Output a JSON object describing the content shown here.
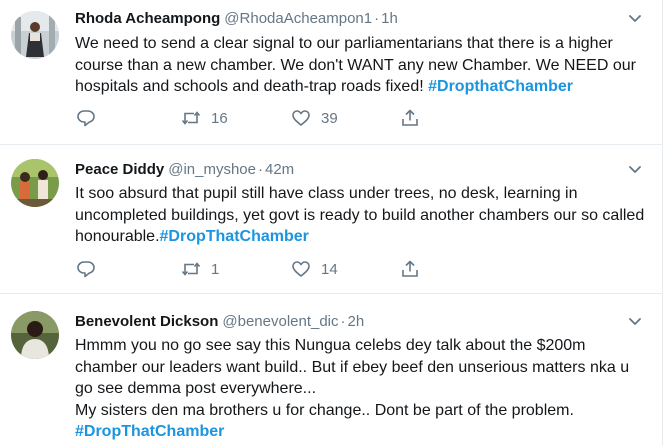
{
  "tweets": [
    {
      "name": "Rhoda Acheampong",
      "handle": "@RhodaAcheampon1",
      "dot": "·",
      "time": "1h",
      "text": "We need to send a clear signal to our parliamentarians that there is a higher course than a new chamber. We don't WANT any new Chamber. We NEED our hospitals and schools and death-trap roads fixed! ",
      "hashtag": "#DropthatChamber",
      "retweets": "16",
      "likes": "39",
      "avatar_color": "#b9c3c9"
    },
    {
      "name": "Peace Diddy",
      "handle": "@in_myshoe",
      "dot": "·",
      "time": "42m",
      "text": "It soo absurd that pupil still have class under trees, no desk, learning in uncompleted buildings, yet govt is ready to build another chambers our so called honourable.",
      "hashtag": "#DropThatChamber",
      "retweets": "1",
      "likes": "14",
      "avatar_color": "#5e7f3a"
    },
    {
      "name": "Benevolent Dickson",
      "handle": "@benevolent_dic",
      "dot": "·",
      "time": "2h",
      "text_lines": [
        "Hmmm you  no go see say  this Nungua celebs dey talk about the $200m chamber our leaders want build.. But if ebey beef den unserious matters nka u go see demma post everywhere...",
        "My sisters den ma brothers u for change.. Dont be part of the problem."
      ],
      "hashtag": "#DropThatChamber",
      "avatar_color": "#3e4a2f"
    }
  ],
  "colors": {
    "text": "#14171a",
    "secondary": "#657786",
    "hashtag": "#1b95e0",
    "divider": "#e6ecf0"
  },
  "icons": [
    "reply-icon",
    "retweet-icon",
    "like-icon",
    "share-icon",
    "chevron-down-icon"
  ]
}
